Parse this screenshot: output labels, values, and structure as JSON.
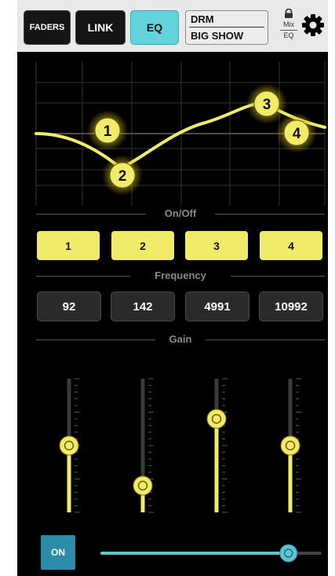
{
  "toolbar": {
    "faders_label": "FADERS",
    "link_label": "LINK",
    "eq_label": "EQ",
    "eq_active_color": "#62d3db"
  },
  "scene": {
    "line1": "DRM",
    "line2": "BIG SHOW"
  },
  "view_toggle": {
    "top": "Mix",
    "bottom": "EQ",
    "icons": [
      "lock-icon",
      "gear-icon"
    ]
  },
  "sections": {
    "onoff": "On/Off",
    "frequency": "Frequency",
    "gain": "Gain"
  },
  "bands": [
    {
      "label": "1",
      "on": true,
      "frequency": "92",
      "gain_level": 0.5
    },
    {
      "label": "2",
      "on": true,
      "frequency": "142",
      "gain_level": 0.2
    },
    {
      "label": "3",
      "on": true,
      "frequency": "4991",
      "gain_level": 0.7
    },
    {
      "label": "4",
      "on": true,
      "frequency": "10992",
      "gain_level": 0.5
    }
  ],
  "accent_color": "#f0ec6a",
  "footer": {
    "on_label": "ON",
    "on_color": "#2a8ca6",
    "level": 0.85
  }
}
